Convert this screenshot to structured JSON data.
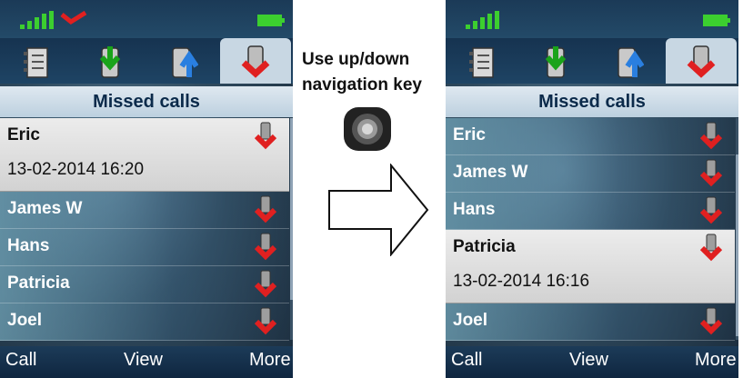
{
  "instruction": {
    "line1": "Use up/down",
    "line2": "navigation key"
  },
  "left_screen": {
    "title": "Missed calls",
    "selected": {
      "name": "Eric",
      "datetime": "13-02-2014 16:20"
    },
    "items": [
      {
        "name": "James W"
      },
      {
        "name": "Hans"
      },
      {
        "name": "Patricia"
      },
      {
        "name": "Joel"
      }
    ],
    "softkeys": {
      "left": "Call",
      "center": "View",
      "right": "More"
    }
  },
  "right_screen": {
    "title": "Missed calls",
    "items_before": [
      {
        "name": "Eric"
      },
      {
        "name": "James W"
      },
      {
        "name": "Hans"
      }
    ],
    "selected": {
      "name": "Patricia",
      "datetime": "13-02-2014 16:16"
    },
    "items_after": [
      {
        "name": "Joel"
      }
    ],
    "softkeys": {
      "left": "Call",
      "center": "View",
      "right": "More"
    }
  },
  "icons": {
    "tabs": [
      "phonebook-icon",
      "received-calls-icon",
      "dialed-calls-icon",
      "missed-calls-icon"
    ],
    "status": [
      "signal-strength-icon",
      "missed-call-indicator-icon",
      "battery-icon"
    ]
  },
  "colors": {
    "accent_red": "#e02020",
    "battery_green": "#3ccf2f",
    "header_blue": "#1b3a57"
  }
}
